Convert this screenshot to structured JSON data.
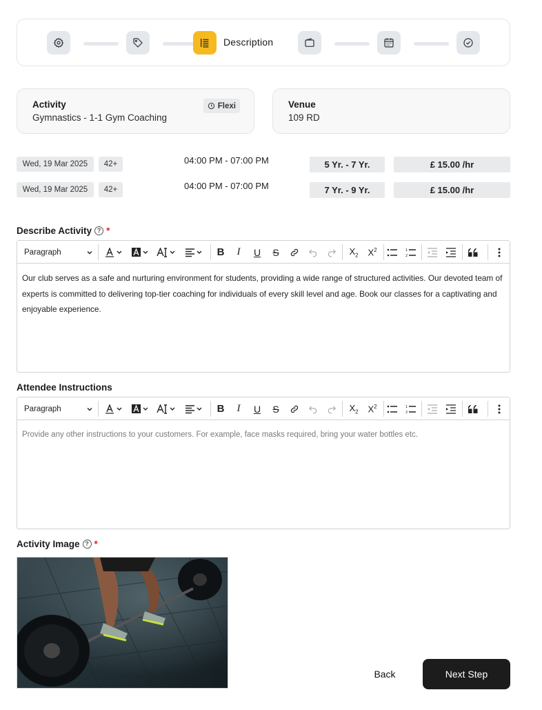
{
  "stepper": {
    "active_label": "Description",
    "steps": [
      {
        "icon": "gear-icon"
      },
      {
        "icon": "tag-icon"
      },
      {
        "icon": "description-icon"
      },
      {
        "icon": "wallet-icon"
      },
      {
        "icon": "calendar-icon"
      },
      {
        "icon": "check-circle-icon"
      }
    ],
    "active_color": "#f6b91f"
  },
  "activity_card": {
    "title": "Activity",
    "value": "Gymnastics - 1-1 Gym Coaching",
    "badge": "Flexi"
  },
  "venue_card": {
    "title": "Venue",
    "value": "109 RD"
  },
  "schedule": [
    {
      "date": "Wed, 19 Mar 2025",
      "spots": "42+",
      "time": "04:00 PM - 07:00 PM",
      "age": "5 Yr. - 7 Yr.",
      "price": "£ 15.00 /hr"
    },
    {
      "date": "Wed, 19 Mar 2025",
      "spots": "42+",
      "time": "04:00 PM - 07:00 PM",
      "age": "7 Yr. - 9 Yr.",
      "price": "£ 15.00 /hr"
    }
  ],
  "describe": {
    "label": "Describe Activity",
    "required": "*",
    "format": "Paragraph",
    "content": "Our club serves as a safe and nurturing environment for students, providing a wide range of structured activities. Our devoted team of experts is committed to delivering top-tier coaching for individuals of every skill level and age. Book our classes for a captivating and enjoyable experience."
  },
  "instructions": {
    "label": "Attendee Instructions",
    "format": "Paragraph",
    "placeholder": "Provide any other instructions to your customers. For example, face masks required, bring your water bottles etc."
  },
  "image_section": {
    "label": "Activity Image",
    "required": "*"
  },
  "actions": {
    "back": "Back",
    "next": "Next Step"
  }
}
